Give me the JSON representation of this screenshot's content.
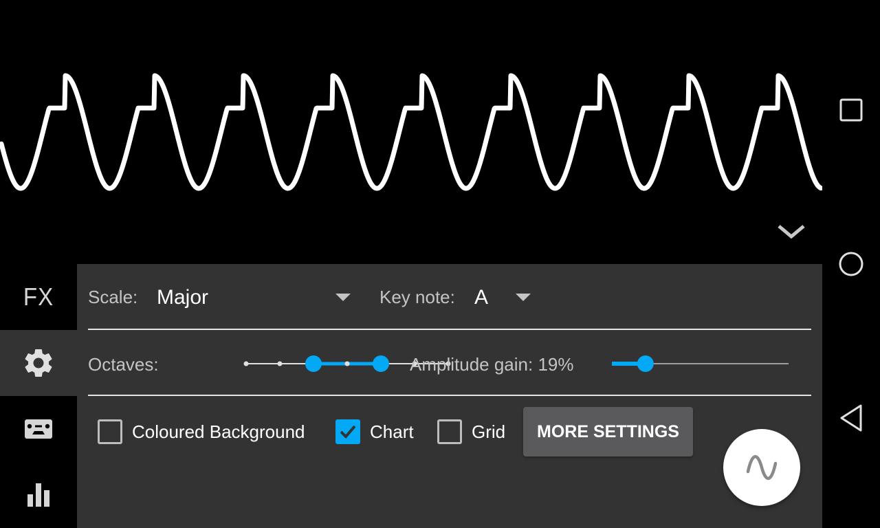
{
  "waveform": {
    "cycles": 9.2,
    "waveform_type": "clipped-sine",
    "color": "#ffffff"
  },
  "rail": {
    "items": [
      {
        "id": "fx",
        "label": "FX",
        "icon": "fx-text",
        "active": false
      },
      {
        "id": "settings",
        "icon": "gear-icon",
        "active": true
      },
      {
        "id": "recordings",
        "icon": "cassette-icon",
        "active": false
      },
      {
        "id": "spectrum",
        "icon": "bar-chart-icon",
        "active": false
      }
    ]
  },
  "settings": {
    "scale": {
      "label": "Scale:",
      "value": "Major"
    },
    "key_note": {
      "label": "Key note:",
      "value": "A"
    },
    "octaves": {
      "label": "Octaves:",
      "steps": 7,
      "range_start_index": 2,
      "range_end_index": 4
    },
    "amplitude_gain": {
      "label": "Amplitude gain: 19%",
      "value_percent": 19
    },
    "checkboxes": [
      {
        "id": "coloured-background",
        "label": "Coloured Background",
        "checked": false
      },
      {
        "id": "chart",
        "label": "Chart",
        "checked": true
      },
      {
        "id": "grid",
        "label": "Grid",
        "checked": false
      }
    ],
    "more_settings_label": "MORE SETTINGS"
  },
  "fab": {
    "icon": "sine-wave-icon"
  },
  "navbar": {
    "buttons": [
      {
        "id": "recents",
        "icon": "square-icon"
      },
      {
        "id": "home",
        "icon": "circle-icon"
      },
      {
        "id": "back",
        "icon": "triangle-back-icon"
      }
    ]
  },
  "colors": {
    "accent": "#03a9f4",
    "panel": "#333333",
    "background": "#000000",
    "button": "#5a5a5c",
    "text_secondary": "#c4c4c4"
  }
}
